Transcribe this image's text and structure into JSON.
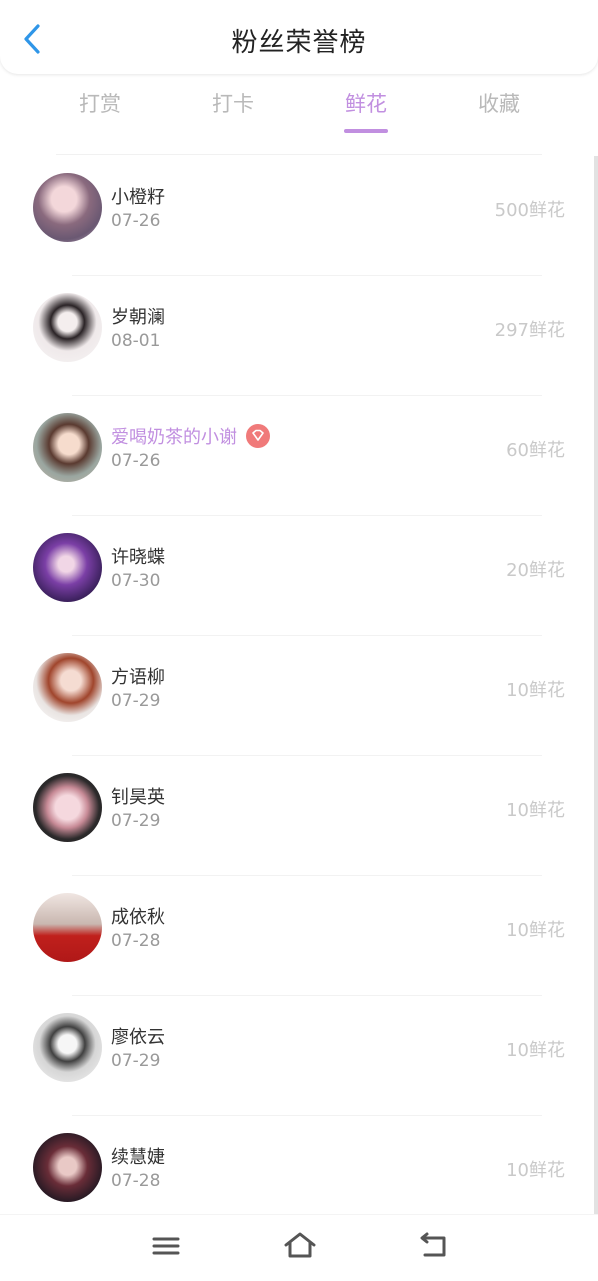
{
  "header": {
    "title": "粉丝荣誉榜",
    "back_icon": "chevron-left-icon"
  },
  "tabs": [
    {
      "label": "打赏",
      "active": false
    },
    {
      "label": "打卡",
      "active": false
    },
    {
      "label": "鲜花",
      "active": true
    },
    {
      "label": "收藏",
      "active": false
    }
  ],
  "colors": {
    "accent": "#c18fe0",
    "back": "#2f96e8",
    "badge": "#f07a7a"
  },
  "fans": [
    {
      "name": "小橙籽",
      "date": "07-26",
      "amount": "500鲜花",
      "vip": false
    },
    {
      "name": "岁朝澜",
      "date": "08-01",
      "amount": "297鲜花",
      "vip": false
    },
    {
      "name": "爱喝奶茶的小谢",
      "date": "07-26",
      "amount": "60鲜花",
      "vip": true,
      "badge_icon": "diamond-badge-icon"
    },
    {
      "name": "许晓蝶",
      "date": "07-30",
      "amount": "20鲜花",
      "vip": false
    },
    {
      "name": "方语柳",
      "date": "07-29",
      "amount": "10鲜花",
      "vip": false
    },
    {
      "name": "钊昊英",
      "date": "07-29",
      "amount": "10鲜花",
      "vip": false
    },
    {
      "name": "成依秋",
      "date": "07-28",
      "amount": "10鲜花",
      "vip": false
    },
    {
      "name": "廖依云",
      "date": "07-29",
      "amount": "10鲜花",
      "vip": false
    },
    {
      "name": "续慧婕",
      "date": "07-28",
      "amount": "10鲜花",
      "vip": false
    }
  ],
  "system_nav": [
    {
      "icon": "menu-icon"
    },
    {
      "icon": "home-icon"
    },
    {
      "icon": "back-icon"
    }
  ]
}
